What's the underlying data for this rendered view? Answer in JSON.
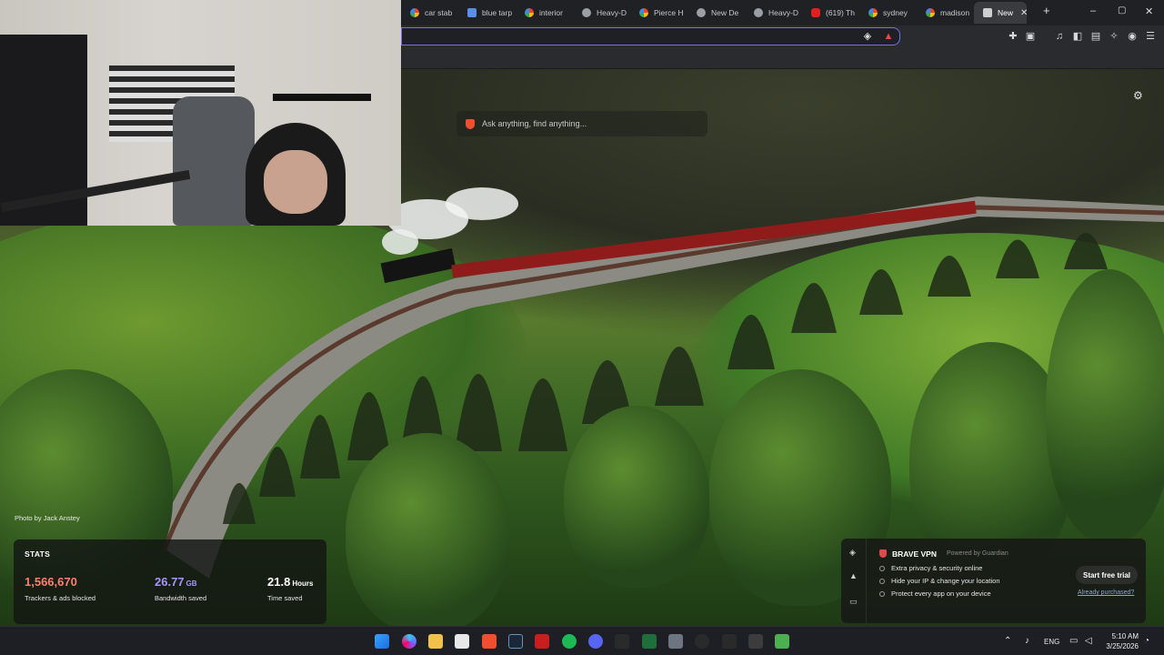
{
  "browser": {
    "tabs": [
      {
        "label": "car stab",
        "icon": "google-icon"
      },
      {
        "label": "blue tarp",
        "icon": "bing-icon"
      },
      {
        "label": "interior",
        "icon": "google-icon"
      },
      {
        "label": "Heavy-D",
        "icon": "site-icon"
      },
      {
        "label": "Pierce H",
        "icon": "google-icon"
      },
      {
        "label": "New De",
        "icon": "site-icon"
      },
      {
        "label": "Heavy-D",
        "icon": "site-icon"
      },
      {
        "label": "(619) Th",
        "icon": "youtube-icon"
      },
      {
        "label": "sydney",
        "icon": "google-icon"
      },
      {
        "label": "madison",
        "icon": "google-icon"
      },
      {
        "label": "New",
        "icon": "brave-icon",
        "active": true
      }
    ],
    "new_tab_symbol": "+",
    "window_controls": {
      "minimize": "–",
      "maximize": "▢",
      "close": "✕"
    }
  },
  "newtab": {
    "search_placeholder": "Ask anything, find anything...",
    "photo_credit": "Photo by Jack Anstey",
    "stats": {
      "header": "STATS",
      "items": [
        {
          "value": "1,566,670",
          "unit": "",
          "label": "Trackers & ads blocked",
          "color": "#ff7f6b"
        },
        {
          "value": "26.77",
          "unit": "GB",
          "label": "Bandwidth saved",
          "color": "#a794ff"
        },
        {
          "value": "21.8",
          "unit": "Hours",
          "label": "Time saved",
          "color": "#ffffff"
        }
      ]
    },
    "vpn": {
      "title": "BRAVE VPN",
      "powered_by": "Powered by  Guardian",
      "features": [
        "Extra privacy & security online",
        "Hide your IP & change your location",
        "Protect every app on your device"
      ],
      "cta": "Start free trial",
      "already_purchased": "Already purchased?"
    }
  },
  "taskbar": {
    "language": "ENG",
    "time": "5:10 AM",
    "date": "3/25/2026"
  }
}
